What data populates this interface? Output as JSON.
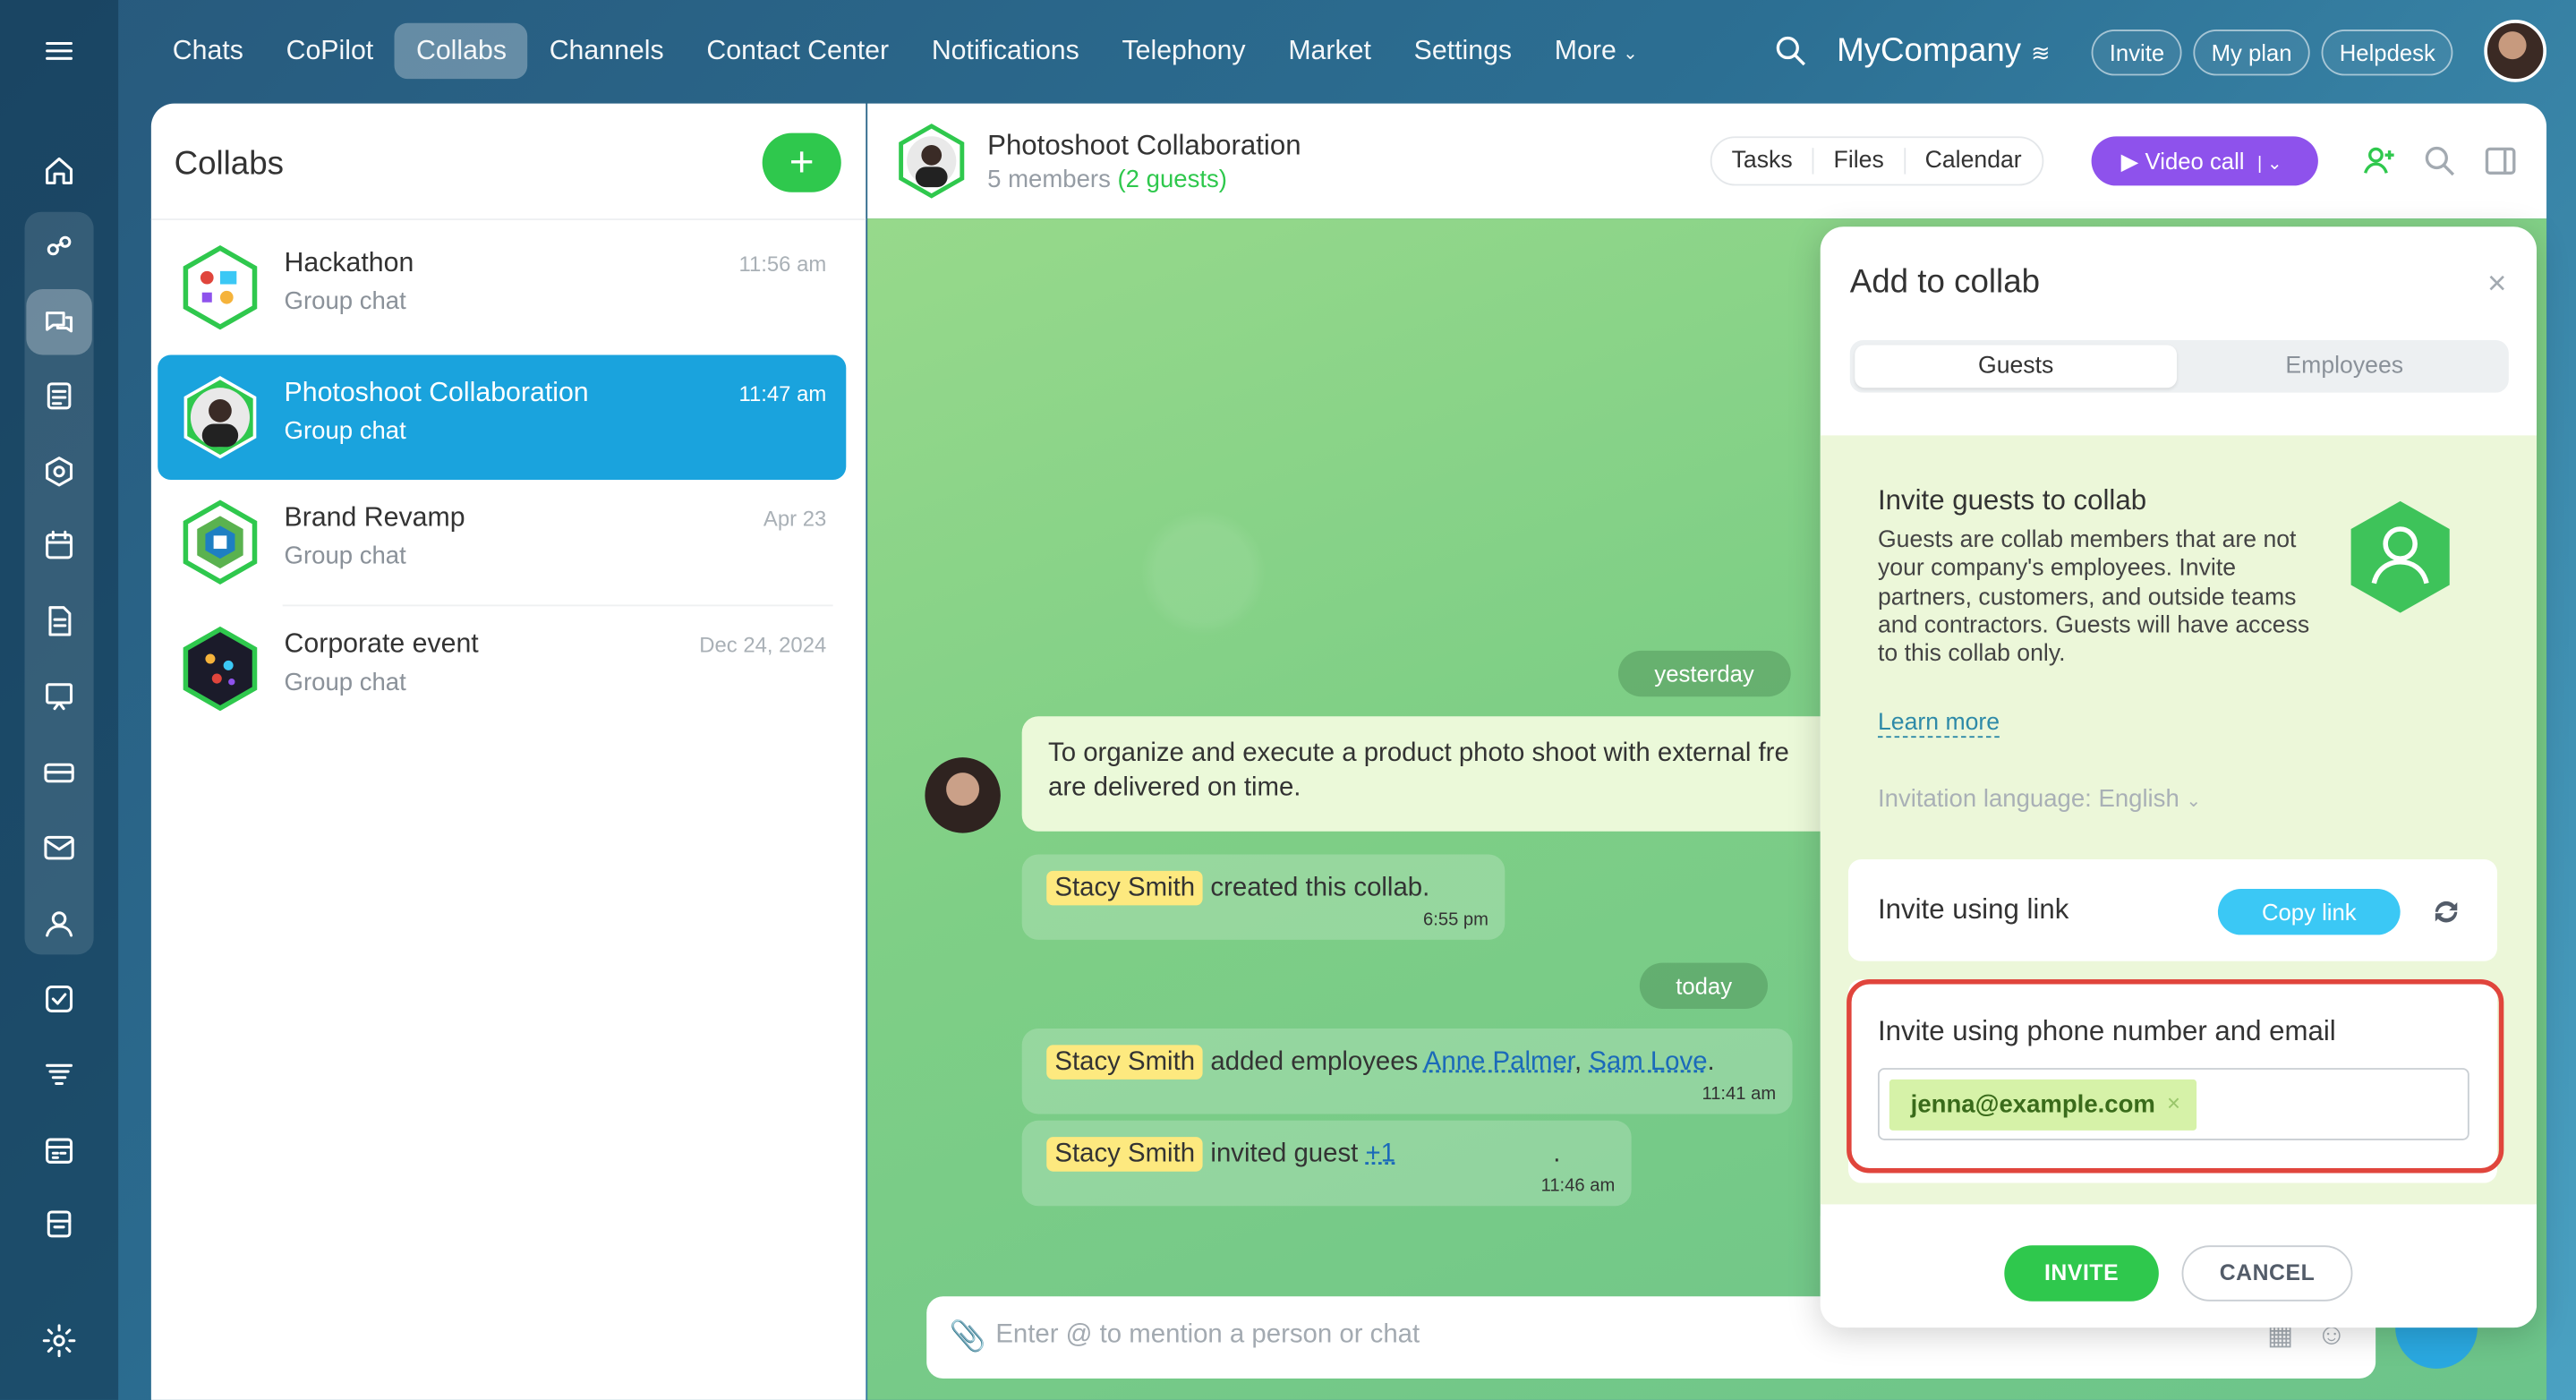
{
  "nav": {
    "tabs": [
      "Chats",
      "CoPilot",
      "Collabs",
      "Channels",
      "Contact Center",
      "Notifications",
      "Telephony",
      "Market",
      "Settings",
      "More"
    ],
    "active_tab": "Collabs",
    "company": "MyCompany",
    "invite": "Invite",
    "my_plan": "My plan",
    "helpdesk": "Helpdesk"
  },
  "sidebar": {
    "icons": [
      "menu-icon",
      "home-icon",
      "copilot-icon",
      "messenger-icon",
      "feed-icon",
      "sites-icon",
      "calendar-icon",
      "document-icon",
      "training-icon",
      "crm-icon",
      "mail-icon",
      "contacts-icon",
      "tasks-icon",
      "automation-icon",
      "schedule-icon",
      "office-icon",
      "settings-icon"
    ]
  },
  "list": {
    "title": "Collabs",
    "add_label": "+",
    "items": [
      {
        "name": "Hackathon",
        "sub": "Group chat",
        "time": "11:56 am"
      },
      {
        "name": "Photoshoot Collaboration",
        "sub": "Group chat",
        "time": "11:47 am"
      },
      {
        "name": "Brand Revamp",
        "sub": "Group chat",
        "time": "Apr 23"
      },
      {
        "name": "Corporate event",
        "sub": "Group chat",
        "time": "Dec 24, 2024"
      }
    ]
  },
  "chat": {
    "title": "Photoshoot Collaboration",
    "members": "5 members",
    "guests": "(2 guests)",
    "tabs": [
      "Tasks",
      "Files",
      "Calendar"
    ],
    "video_call": "Video call",
    "date_yesterday": "yesterday",
    "date_today": "today",
    "first_message_line1": "To organize and execute a product photo shoot with external fre",
    "first_message_line2": "are delivered on time.",
    "event1": {
      "who": "Stacy Smith",
      "text": "created this collab.",
      "time": "6:55 pm"
    },
    "event2": {
      "who": "Stacy Smith",
      "text": "added employees",
      "link1": "Anne Palmer",
      "sep": ",",
      "link2": "Sam Love",
      "end": ".",
      "time": "11:41 am"
    },
    "event3": {
      "who": "Stacy Smith",
      "text": "invited guest",
      "link": "+1",
      "end": ".",
      "time": "11:46 am"
    },
    "input_placeholder": "Enter @ to mention a person or chat"
  },
  "modal": {
    "title": "Add to collab",
    "close": "×",
    "tab_guests": "Guests",
    "tab_employees": "Employees",
    "heading": "Invite guests to collab",
    "description": "Guests are collab members that are not your company's employees. Invite partners, customers, and outside teams and contractors. Guests will have access to this collab only.",
    "learn_more": "Learn more",
    "language_label": "Invitation language:",
    "language_value": "English",
    "link_title": "Invite using link",
    "copy_link": "Copy link",
    "phone_email_title": "Invite using phone number and email",
    "email_chip": "jenna@example.com",
    "chip_remove": "×",
    "invite_btn": "INVITE",
    "cancel_btn": "CANCEL"
  },
  "colors": {
    "accent_green": "#2fc84d",
    "active_blue": "#1aa3dd",
    "video_purple": "#8e52ec",
    "highlight_red": "#e0453c"
  }
}
